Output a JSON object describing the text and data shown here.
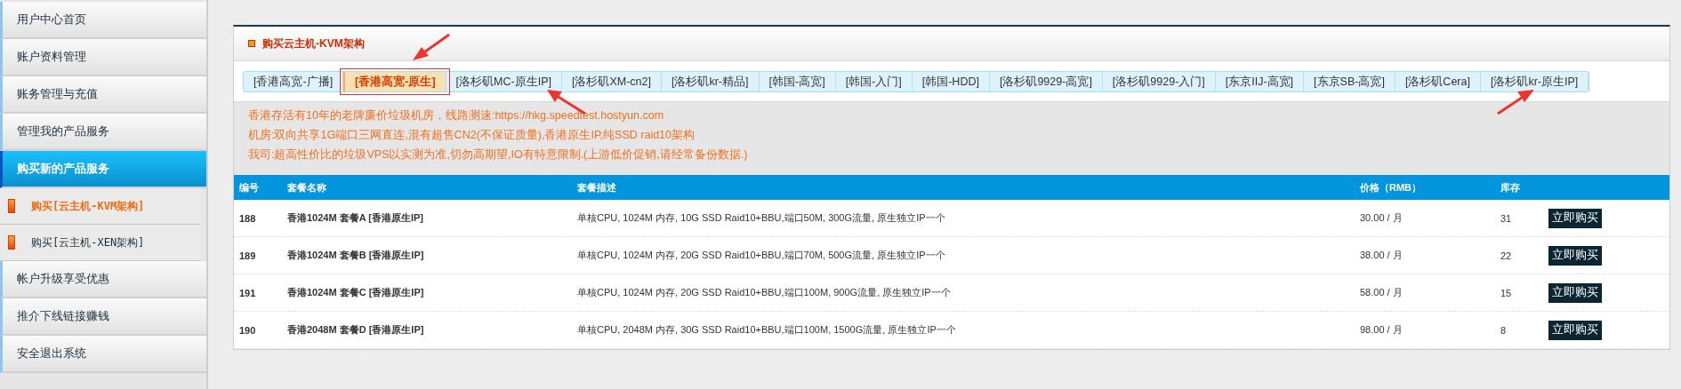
{
  "sidebar": {
    "items": [
      {
        "label": "用户中心首页",
        "selected": false
      },
      {
        "label": "账户资料管理",
        "selected": false
      },
      {
        "label": "账务管理与充值",
        "selected": false
      },
      {
        "label": "管理我的产品服务",
        "selected": false
      },
      {
        "label": "购买新的产品服务",
        "selected": true,
        "children": [
          {
            "label": "购买[云主机-KVM架构]",
            "selected": true
          },
          {
            "label": "购买[云主机-XEN架构]",
            "selected": false
          }
        ]
      },
      {
        "label": "帐户升级享受优惠",
        "selected": false
      },
      {
        "label": "推介下线链接赚钱",
        "selected": false
      },
      {
        "label": "安全退出系统",
        "selected": false
      }
    ]
  },
  "panel": {
    "title": "购买云主机-KVM架构",
    "tabs": [
      {
        "label": "[香港高宽-广播]",
        "selected": false
      },
      {
        "label": "[香港高宽-原生]",
        "selected": true
      },
      {
        "label": "[洛杉矶MC-原生IP]",
        "selected": false
      },
      {
        "label": "[洛杉矶XM-cn2]",
        "selected": false
      },
      {
        "label": "[洛杉矶kr-精品]",
        "selected": false
      },
      {
        "label": "[韩国-高宽]",
        "selected": false
      },
      {
        "label": "[韩国-入门]",
        "selected": false
      },
      {
        "label": "[韩国-HDD]",
        "selected": false
      },
      {
        "label": "[洛杉矶9929-高宽]",
        "selected": false
      },
      {
        "label": "[洛杉矶9929-入门]",
        "selected": false
      },
      {
        "label": "[东京IIJ-高宽]",
        "selected": false
      },
      {
        "label": "[东京SB-高宽]",
        "selected": false
      },
      {
        "label": "[洛杉矶Cera]",
        "selected": false
      },
      {
        "label": "[洛杉矶kr-原生IP]",
        "selected": false
      }
    ],
    "notices": [
      "香港存活有10年的老牌廉价垃圾机房，线路测速:https://hkg.speedtest.hostyun.com",
      "机房:双向共享1G端口三网直连,混有超售CN2(不保证质量),香港原生IP,纯SSD raid10架构",
      "我司:超高性价比的垃圾VPS以实测为准,切勿高期望,IO有特意限制.(上游低价促销,请经常备份数据.)"
    ]
  },
  "table": {
    "columns": [
      "编号",
      "套餐名称",
      "套餐描述",
      "价格（RMB）",
      "库存"
    ],
    "rows": [
      {
        "id": "188",
        "name": "香港1024M 套餐A [香港原生IP]",
        "description": "单核CPU, 1024M 内存, 10G SSD Raid10+BBU,端口50M, 300G流量, 原生独立IP一个",
        "price": "30.00 / 月",
        "stock": "31",
        "action": "立即购买"
      },
      {
        "id": "189",
        "name": "香港1024M 套餐B [香港原生IP]",
        "description": "单核CPU, 1024M 内存, 20G SSD Raid10+BBU,端口70M, 500G流量, 原生独立IP一个",
        "price": "38.00 / 月",
        "stock": "22",
        "action": "立即购买"
      },
      {
        "id": "191",
        "name": "香港1024M 套餐C [香港原生IP]",
        "description": "单核CPU, 1024M 内存, 20G SSD Raid10+BBU,端口100M, 900G流量, 原生独立IP一个",
        "price": "58.00 / 月",
        "stock": "15",
        "action": "立即购买"
      },
      {
        "id": "190",
        "name": "香港2048M 套餐D [香港原生IP]",
        "description": "单核CPU, 2048M 内存, 30G SSD Raid10+BBU,端口100M, 1500G流量, 原生独立IP一个",
        "price": "98.00 / 月",
        "stock": "8",
        "action": "立即购买"
      }
    ]
  }
}
